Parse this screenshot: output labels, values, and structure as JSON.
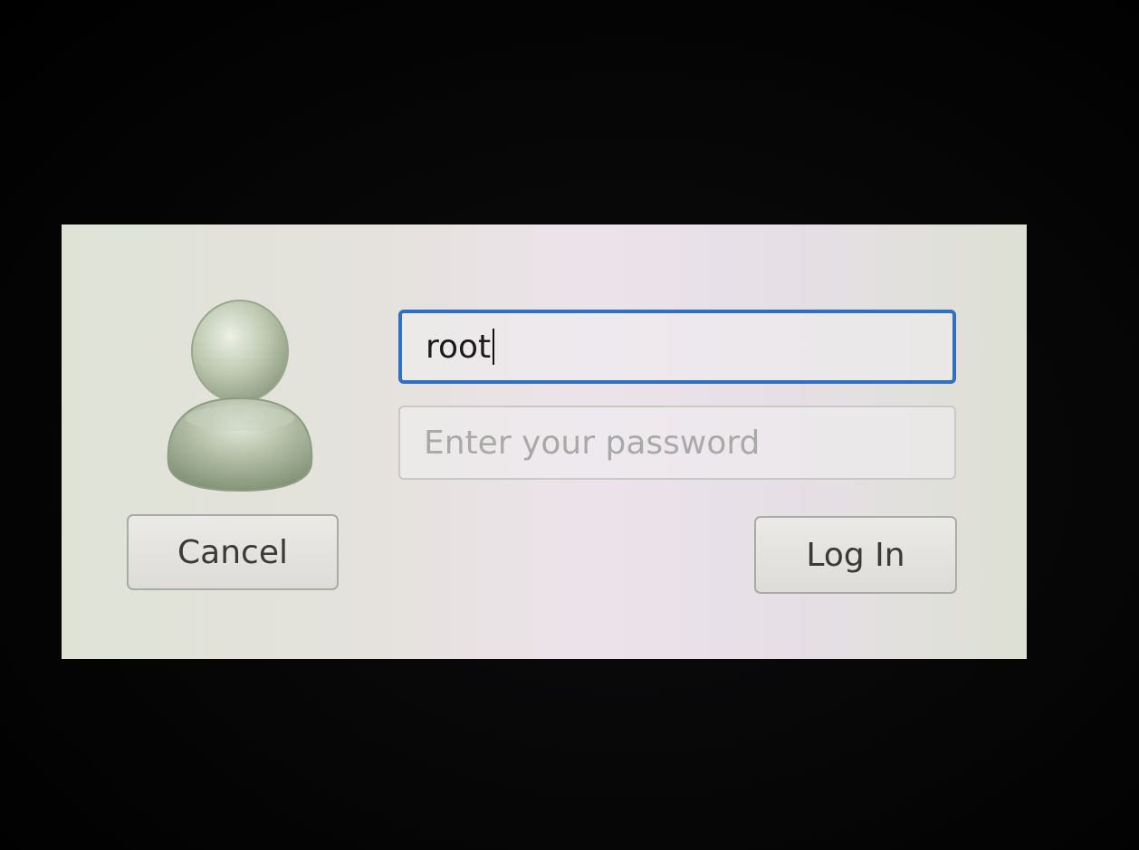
{
  "login": {
    "username_value": "root",
    "password_placeholder": "Enter your password",
    "cancel_label": "Cancel",
    "login_label": "Log In"
  },
  "icons": {
    "avatar": "user-avatar-icon"
  },
  "colors": {
    "focus_border": "#2f6fc4",
    "placeholder_text": "#a9aaa7",
    "dialog_background": "#e4e2e0",
    "screen_background": "#050505"
  }
}
